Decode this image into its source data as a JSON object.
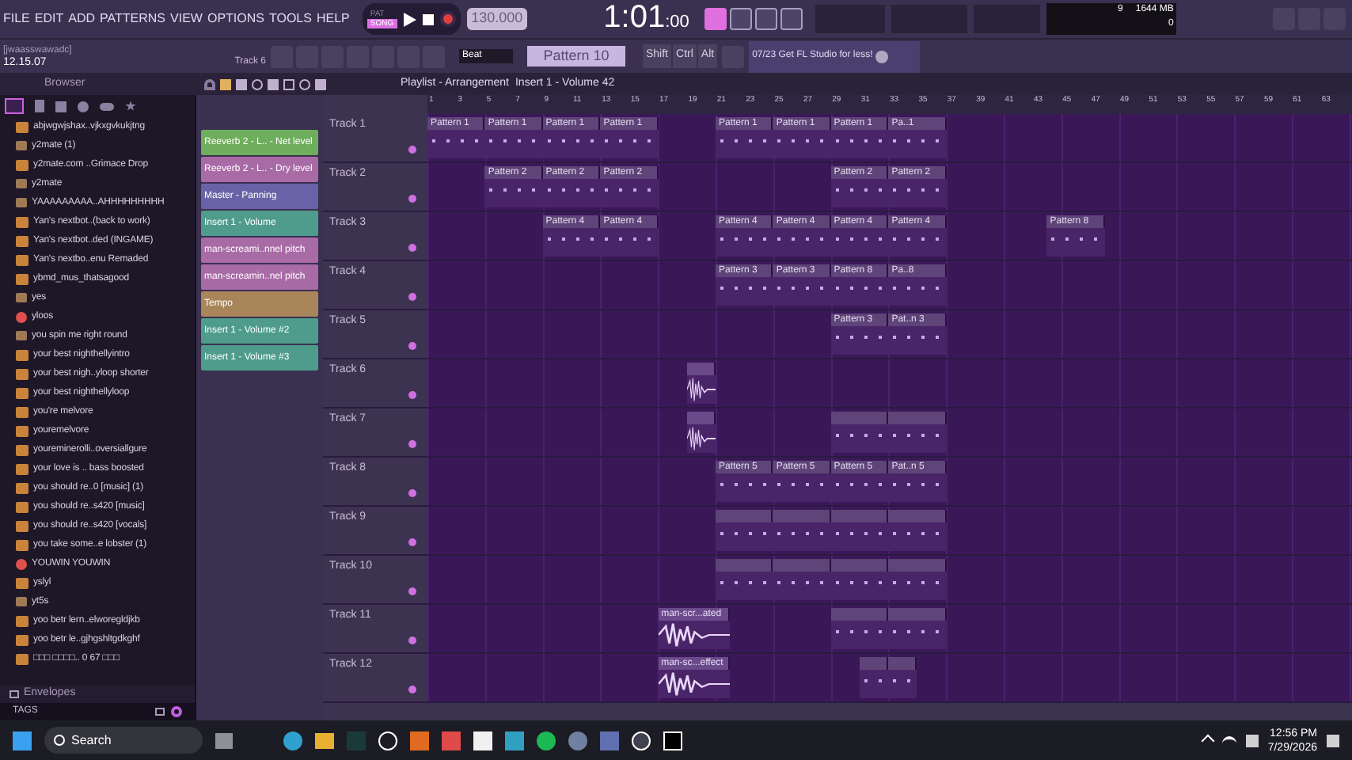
{
  "menu": [
    "FILE",
    "EDIT",
    "ADD",
    "PATTERNS",
    "VIEW",
    "OPTIONS",
    "TOOLS",
    "HELP"
  ],
  "transport": {
    "pat": "PAT",
    "song": "SONG",
    "song_selected": true,
    "tempo": "130.000",
    "time_main": "1:01",
    "time_sub": ":00"
  },
  "hint": {
    "user": "[jwaasswawadc]",
    "time": "12.15.07",
    "target": "Track 6"
  },
  "snap": "Beat",
  "pattern": "Pattern 10",
  "keys": [
    "Shift",
    "Ctrl",
    "Alt"
  ],
  "news": "07/23  Get FL Studio for less!",
  "monitor": {
    "cpu": "9",
    "memory": "1644 MB",
    "polyphony": "0"
  },
  "browser": {
    "title": "Browser",
    "items": [
      {
        "label": "abjwgwjshax..vjkxgvkukjtng",
        "kind": "audio"
      },
      {
        "label": "y2mate (1)",
        "kind": "file"
      },
      {
        "label": "y2mate.com ..Grimace Drop",
        "kind": "audio"
      },
      {
        "label": "y2mate",
        "kind": "file"
      },
      {
        "label": "YAAAAAAAAA..AHHHHHHHHH",
        "kind": "file"
      },
      {
        "label": "Yan's nextbot..(back to work)",
        "kind": "audio"
      },
      {
        "label": "Yan's nextbot..ded (INGAME)",
        "kind": "audio"
      },
      {
        "label": "Yan's nextbo..enu Remaded",
        "kind": "audio"
      },
      {
        "label": "ybmd_mus_thatsagood",
        "kind": "audio"
      },
      {
        "label": "yes",
        "kind": "file"
      },
      {
        "label": "yloos",
        "kind": "project"
      },
      {
        "label": "you spin me right round",
        "kind": "file"
      },
      {
        "label": "your best nighthellyintro",
        "kind": "audio"
      },
      {
        "label": "your best nigh..yloop shorter",
        "kind": "audio"
      },
      {
        "label": "your best nighthellyloop",
        "kind": "audio"
      },
      {
        "label": "you're melvore",
        "kind": "audio"
      },
      {
        "label": "youremelvore",
        "kind": "audio"
      },
      {
        "label": "youreminerolli..oversiallgure",
        "kind": "audio"
      },
      {
        "label": "your love is .. bass boosted",
        "kind": "audio"
      },
      {
        "label": "you should re..0 [music] (1)",
        "kind": "audio"
      },
      {
        "label": "you should re..s420 [music]",
        "kind": "audio"
      },
      {
        "label": "you should re..s420 [vocals]",
        "kind": "audio"
      },
      {
        "label": "you take some..e lobster (1)",
        "kind": "audio"
      },
      {
        "label": "YOUWIN YOUWIN",
        "kind": "project"
      },
      {
        "label": "yslyl",
        "kind": "audio"
      },
      {
        "label": "yt5s",
        "kind": "file"
      },
      {
        "label": "yoo betr lern..elworegldjkb",
        "kind": "audio"
      },
      {
        "label": "yoo betr le..gjhgshltgdkghf",
        "kind": "audio"
      },
      {
        "label": "□□□ □□□□.. 0 67 □□□",
        "kind": "audio"
      }
    ],
    "envelopes": "Envelopes",
    "tags": "TAGS"
  },
  "playlist": {
    "title": "Playlist - Arrangement",
    "path": "Insert 1 - Volume 42",
    "clip_list": [
      {
        "label": "Reeverb 2 - L.. - Net level",
        "color": "#6fae5c"
      },
      {
        "label": "Reeverb 2 - L.. - Dry level",
        "color": "#a86ba6"
      },
      {
        "label": "Master - Panning",
        "color": "#6a62a6"
      },
      {
        "label": "Insert 1 - Volume",
        "color": "#4f9c8c"
      },
      {
        "label": "man-screami..nnel pitch",
        "color": "#a86ba6"
      },
      {
        "label": "man-screamin..nel pitch",
        "color": "#a86ba6"
      },
      {
        "label": "Tempo",
        "color": "#a8865a"
      },
      {
        "label": "Insert 1 - Volume #2",
        "color": "#4f9c8c"
      },
      {
        "label": "Insert 1 - Volume #3",
        "color": "#4f9c8c"
      }
    ],
    "ruler": [
      "1",
      "3",
      "5",
      "7",
      "9",
      "11",
      "13",
      "15",
      "17",
      "19",
      "21",
      "23",
      "25",
      "27",
      "29",
      "31",
      "33",
      "35",
      "37",
      "39",
      "41",
      "43",
      "45",
      "47",
      "49",
      "51",
      "53",
      "55",
      "57",
      "59",
      "61",
      "63"
    ],
    "tracks": [
      {
        "name": "Track 1",
        "clips": [
          {
            "kind": "pattern",
            "label": "Pattern 1"
          },
          {
            "kind": "pattern",
            "label": "Pattern 1"
          },
          {
            "kind": "pattern",
            "label": "Pattern 1"
          },
          {
            "kind": "pattern",
            "label": "Pattern 1"
          },
          {
            "kind": "pattern",
            "label": "Pattern 1"
          },
          {
            "kind": "pattern",
            "label": "Pattern 1"
          },
          {
            "kind": "pattern",
            "label": "Pattern 1"
          },
          {
            "kind": "pattern",
            "label": "Pa..1"
          }
        ]
      },
      {
        "name": "Track 2",
        "clips": [
          {
            "kind": "pattern",
            "label": "Pattern 2"
          },
          {
            "kind": "pattern",
            "label": "Pattern 2"
          },
          {
            "kind": "pattern",
            "label": "Pattern 2"
          },
          {
            "kind": "pattern",
            "label": "Pattern 2"
          },
          {
            "kind": "pattern",
            "label": "Pattern 2"
          }
        ]
      },
      {
        "name": "Track 3",
        "clips": [
          {
            "kind": "pattern",
            "label": "Pattern 4"
          },
          {
            "kind": "pattern",
            "label": "Pattern 4"
          },
          {
            "kind": "pattern",
            "label": "Pattern 4"
          },
          {
            "kind": "pattern",
            "label": "Pattern 4"
          },
          {
            "kind": "pattern",
            "label": "Pattern 4"
          },
          {
            "kind": "pattern",
            "label": "Pattern 4"
          },
          {
            "kind": "pattern",
            "label": "Pattern 8"
          }
        ]
      },
      {
        "name": "Track 4",
        "clips": [
          {
            "kind": "pattern",
            "label": "Pattern 3"
          },
          {
            "kind": "pattern",
            "label": "Pattern 3"
          },
          {
            "kind": "pattern",
            "label": "Pattern 8"
          },
          {
            "kind": "pattern",
            "label": "Pa..8"
          }
        ]
      },
      {
        "name": "Track 5",
        "clips": [
          {
            "kind": "pattern",
            "label": "Pattern 3"
          },
          {
            "kind": "pattern",
            "label": "Pat..n 3"
          }
        ]
      },
      {
        "name": "Track 6",
        "clips": [
          {
            "kind": "audio"
          }
        ]
      },
      {
        "name": "Track 7",
        "clips": [
          {
            "kind": "audio"
          },
          {
            "kind": "pattern"
          },
          {
            "kind": "pattern"
          }
        ]
      },
      {
        "name": "Track 8",
        "clips": [
          {
            "kind": "pattern",
            "label": "Pattern 5"
          },
          {
            "kind": "pattern",
            "label": "Pattern 5"
          },
          {
            "kind": "pattern",
            "label": "Pattern 5"
          },
          {
            "kind": "pattern",
            "label": "Pat..n 5"
          }
        ]
      },
      {
        "name": "Track 9",
        "clips": [
          {
            "kind": "pattern"
          },
          {
            "kind": "pattern"
          },
          {
            "kind": "pattern"
          },
          {
            "kind": "pattern"
          }
        ]
      },
      {
        "name": "Track 10",
        "clips": [
          {
            "kind": "pattern"
          },
          {
            "kind": "pattern"
          },
          {
            "kind": "pattern"
          },
          {
            "kind": "pattern"
          }
        ]
      },
      {
        "name": "Track 11",
        "clips": [
          {
            "kind": "audio",
            "label": "man-scr...ated"
          },
          {
            "kind": "pattern"
          },
          {
            "kind": "pattern"
          }
        ]
      },
      {
        "name": "Track 12",
        "clips": [
          {
            "kind": "audio",
            "label": "man-sc...effect"
          },
          {
            "kind": "pattern"
          },
          {
            "kind": "pattern"
          }
        ]
      }
    ]
  },
  "taskbar": {
    "search": "Search",
    "time": "12:56 PM",
    "date": "7/29/2026"
  }
}
